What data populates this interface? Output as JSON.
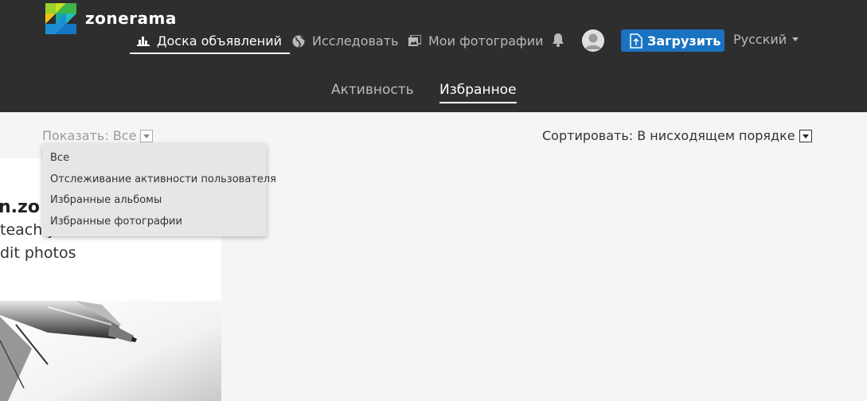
{
  "brand": {
    "name": "zonerama"
  },
  "nav": {
    "items": [
      {
        "label": "Доска объявлений",
        "icon": "bar-chart-icon",
        "active": true
      },
      {
        "label": "Исследовать",
        "icon": "globe-icon",
        "active": false
      },
      {
        "label": "Мои фотографии",
        "icon": "photos-icon",
        "active": false
      }
    ],
    "upload_label": "Загрузить",
    "language": "Русский"
  },
  "subnav": {
    "tabs": [
      {
        "label": "Активность",
        "active": false
      },
      {
        "label": "Избранное",
        "active": true
      }
    ]
  },
  "filter": {
    "show_label": "Показать: Все",
    "options": [
      "Все",
      "Отслеживание активности пользователя",
      "Избранные альбомы",
      "Избранные фотографии"
    ]
  },
  "sort": {
    "label": "Сортировать: В нисходящем порядке"
  },
  "card": {
    "title": "n.zo",
    "line1": "teach y",
    "line2": "dit photos"
  },
  "colors": {
    "header_bg": "#2e2e2e",
    "accent": "#1a73c2",
    "page_bg": "#f5f5f5"
  }
}
